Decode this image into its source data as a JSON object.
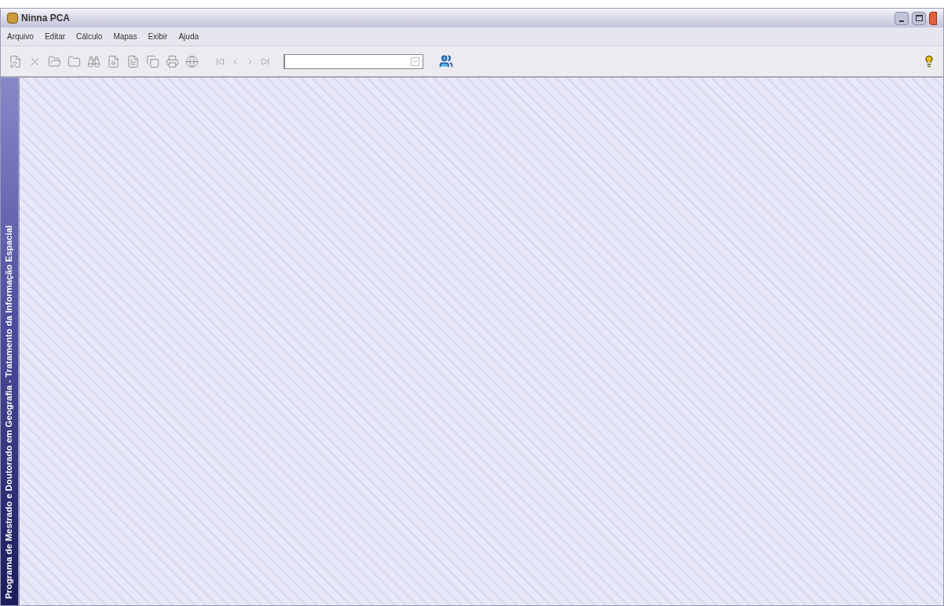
{
  "window": {
    "title": "Ninna PCA"
  },
  "menu": [
    "Arquivo",
    "Editar",
    "Cálculo",
    "Mapas",
    "Exibir",
    "Ajuda"
  ],
  "sidebar": {
    "text": "Programa de Mestrado e Doutorado em Geografia - Tratamento da Informação Espacial"
  }
}
